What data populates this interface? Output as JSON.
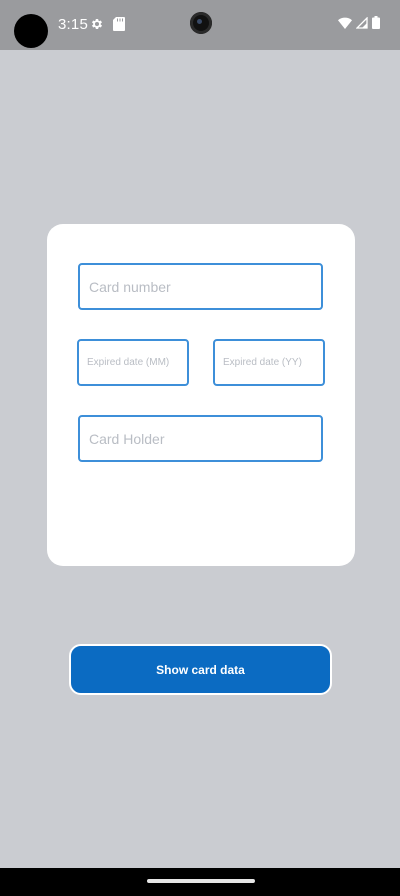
{
  "status_bar": {
    "time": "3:15",
    "icons": [
      "settings-gear-icon",
      "sd-card-icon",
      "wifi-icon",
      "cell-signal-icon",
      "battery-icon"
    ],
    "background": "#9a9b9e"
  },
  "form": {
    "card_number": {
      "placeholder": "Card number",
      "value": ""
    },
    "expired_month": {
      "placeholder": "Expired date (MM)",
      "value": ""
    },
    "expired_year": {
      "placeholder": "Expired date (YY)",
      "value": ""
    },
    "card_holder": {
      "placeholder": "Card Holder",
      "value": ""
    }
  },
  "actions": {
    "show_card_data_label": "Show card data"
  },
  "colors": {
    "screen_background": "#caccd1",
    "field_border": "#3d8fd9",
    "placeholder_text": "#b9bdc4",
    "primary_button": "#0b6bc2",
    "card_background": "#ffffff"
  }
}
